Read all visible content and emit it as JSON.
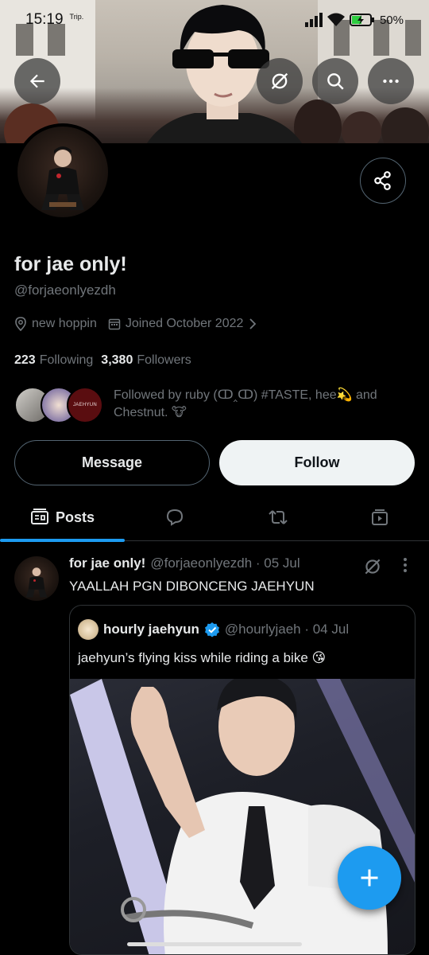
{
  "status_bar": {
    "time": "15:19",
    "carrier": "Trip.",
    "battery": "50%"
  },
  "header": {
    "back_icon": "arrow-left-icon",
    "grok_icon": "grok-icon",
    "search_icon": "search-icon",
    "more_icon": "more-horizontal-icon"
  },
  "profile": {
    "name": "for jae only!",
    "handle": "@forjaeonlyezdh",
    "location": "new hoppin",
    "joined": "Joined October 2022",
    "following_count": "223",
    "following_label": "Following",
    "followers_count": "3,380",
    "followers_label": "Followers",
    "followed_by": "Followed by ruby (ↀ‸ↀ) #TASTE, hee💫 and Chestnut. 🐮",
    "mini_avatar_text": "JAEHYUN"
  },
  "actions": {
    "message": "Message",
    "follow": "Follow"
  },
  "tabs": [
    {
      "label": "Posts",
      "icon": "posts-icon",
      "active": true
    },
    {
      "label": "",
      "icon": "reply-icon"
    },
    {
      "label": "",
      "icon": "repost-icon"
    },
    {
      "label": "",
      "icon": "media-icon"
    }
  ],
  "post": {
    "name": "for jae only!",
    "meta": "@forjaeonlyezdh · 05 Jul",
    "text": "YAALLAH PGN DIBONCENG JAEHYUN",
    "quote": {
      "name": "hourly jaehyun",
      "meta": "@hourlyjaeh · 04 Jul",
      "text": "jaehyun’s flying kiss while riding a bike 😘",
      "verified": true
    }
  },
  "colors": {
    "accent": "#1d9bf0",
    "background": "#000000",
    "text_secondary": "#71767b"
  }
}
